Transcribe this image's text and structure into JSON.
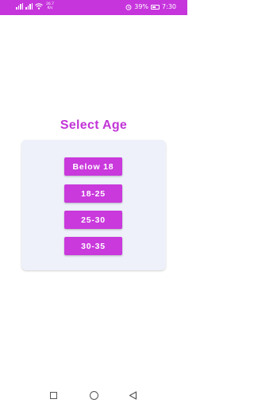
{
  "status_bar": {
    "net_speed_value": "26.7",
    "net_speed_unit": "K/s",
    "battery_percent": "39%",
    "time": "7:30",
    "background_color": "#c635dc"
  },
  "title": "Select Age",
  "age_options": [
    {
      "label": "Below 18"
    },
    {
      "label": "18-25"
    },
    {
      "label": "25-30"
    },
    {
      "label": "30-35"
    }
  ],
  "colors": {
    "accent": "#c939dc",
    "card_background": "#eef1f9"
  },
  "icons": {
    "status_left": [
      "signal-icon",
      "signal-icon",
      "wifi-icon"
    ],
    "status_right": [
      "alarm-icon",
      "battery-icon"
    ],
    "navigation": [
      "recents-icon",
      "home-icon",
      "back-icon"
    ]
  }
}
